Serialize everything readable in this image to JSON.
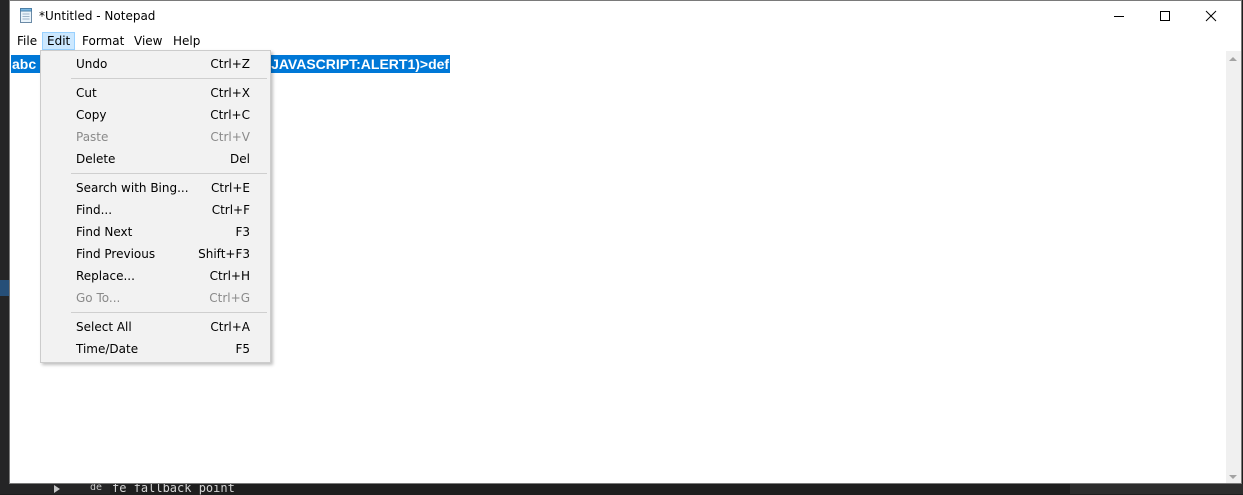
{
  "window": {
    "title": "*Untitled - Notepad",
    "icon": "notepad-icon",
    "controls": [
      "minimize-icon",
      "maximize-icon",
      "close-icon"
    ]
  },
  "menubar": {
    "items": [
      {
        "label": "File"
      },
      {
        "label": "Edit"
      },
      {
        "label": "Format"
      },
      {
        "label": "View"
      },
      {
        "label": "Help"
      }
    ],
    "active": "Edit"
  },
  "editor": {
    "selected_text": "abc                                     EXPRESSIONJAVASCRIPT:ALERT1)>def",
    "selection_color": "#0078d7"
  },
  "edit_menu": {
    "items": [
      {
        "label": "Undo",
        "shortcut": "Ctrl+Z"
      },
      {
        "label": "Cut",
        "shortcut": "Ctrl+X"
      },
      {
        "label": "Copy",
        "shortcut": "Ctrl+C"
      },
      {
        "label": "Paste",
        "shortcut": "Ctrl+V"
      },
      {
        "label": "Delete",
        "shortcut": "Del"
      },
      {
        "label": "Search with Bing...",
        "shortcut": "Ctrl+E"
      },
      {
        "label": "Find...",
        "shortcut": "Ctrl+F"
      },
      {
        "label": "Find Next",
        "shortcut": "F3"
      },
      {
        "label": "Find Previous",
        "shortcut": "Shift+F3"
      },
      {
        "label": "Replace...",
        "shortcut": "Ctrl+H"
      },
      {
        "label": "Go To...",
        "shortcut": "Ctrl+G"
      },
      {
        "label": "Select All",
        "shortcut": "Ctrl+A"
      },
      {
        "label": "Time/Date",
        "shortcut": "F5"
      }
    ],
    "disabled": [
      "Paste",
      "Go To..."
    ]
  },
  "background_editor": {
    "gutter_label": "de",
    "code_line": "fe fallback point"
  },
  "colors": {
    "menu_highlight": "#cce8ff",
    "menu_background": "#f2f2f2",
    "disabled_text": "#8a8a8a"
  }
}
